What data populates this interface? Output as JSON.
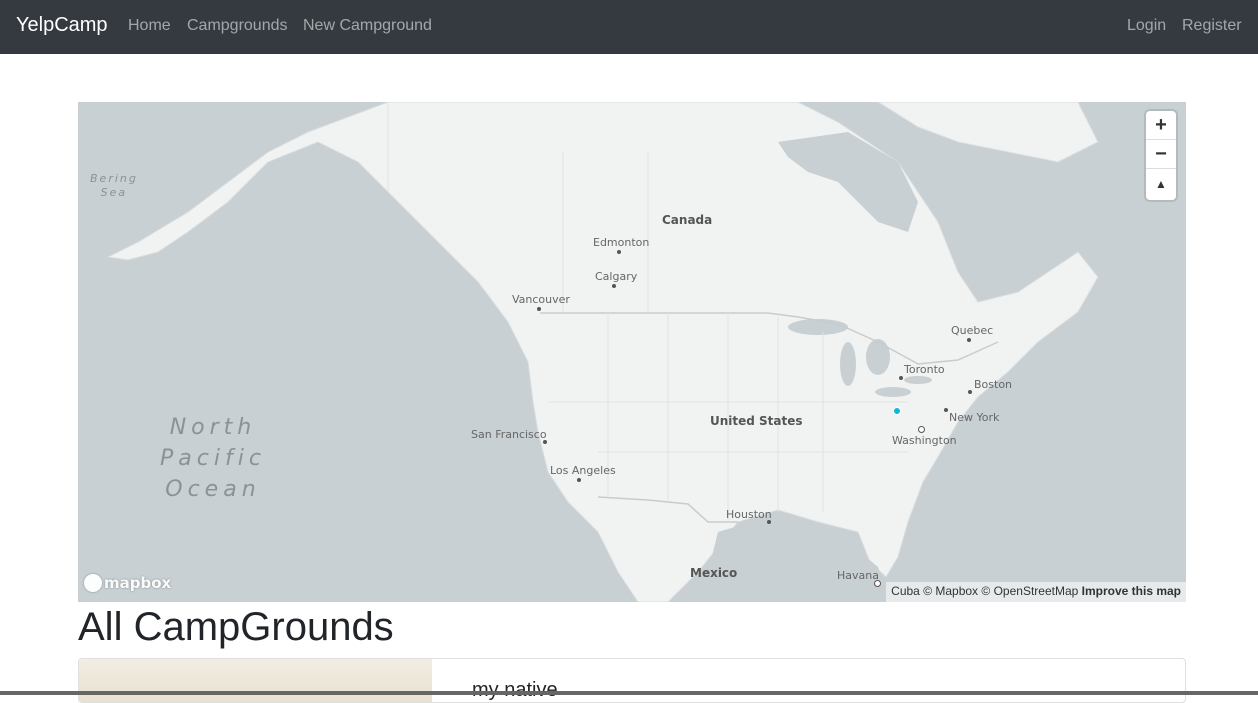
{
  "nav": {
    "brand": "YelpCamp",
    "home": "Home",
    "campgrounds": "Campgrounds",
    "new_campground": "New Campground",
    "login": "Login",
    "register": "Register"
  },
  "map": {
    "labels": {
      "canada": "Canada",
      "united_states": "United States",
      "mexico": "Mexico",
      "edmonton": "Edmonton",
      "calgary": "Calgary",
      "vancouver": "Vancouver",
      "quebec": "Quebec",
      "toronto": "Toronto",
      "boston": "Boston",
      "new_york": "New York",
      "washington": "Washington",
      "san_francisco": "San Francisco",
      "los_angeles": "Los Angeles",
      "houston": "Houston",
      "havana": "Havana",
      "cuba": "Cuba",
      "bering_sea_1": "Bering",
      "bering_sea_2": "Sea",
      "ocean_1": "North",
      "ocean_2": "Pacific",
      "ocean_3": "Ocean"
    },
    "controls": {
      "zoom_in": "+",
      "zoom_out": "−",
      "compass": "▲"
    },
    "logo": "mapbox",
    "attribution": {
      "mapbox": "© Mapbox",
      "osm": "© OpenStreetMap",
      "improve": "Improve this map"
    },
    "colors": {
      "water": "#c8d0d3",
      "land": "#f2f2f2",
      "marker": "#11b4da"
    }
  },
  "page": {
    "heading": "All CampGrounds"
  },
  "campgrounds": [
    {
      "title": "my native"
    }
  ]
}
